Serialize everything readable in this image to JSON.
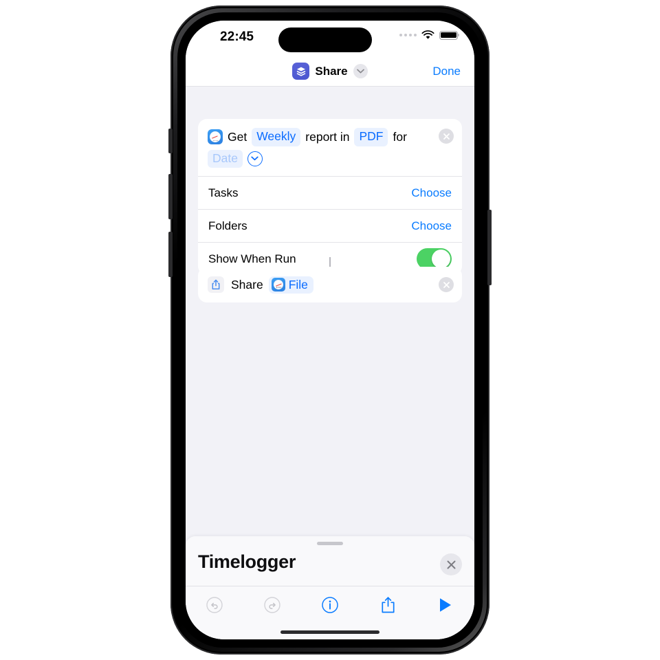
{
  "status_bar": {
    "time": "22:45",
    "cellular_icon": "cellular-dots-icon",
    "wifi_icon": "wifi-icon",
    "battery_icon": "battery-full-icon"
  },
  "nav_bar": {
    "app_icon": "shortcuts-app-icon",
    "title": "Share",
    "chevron_icon": "chevron-down-icon",
    "done_label": "Done"
  },
  "actions": [
    {
      "id": "get-report",
      "app_icon": "timelogger-app-icon",
      "phrase": [
        {
          "kind": "text",
          "value": "Get"
        },
        {
          "kind": "token",
          "value": "Weekly"
        },
        {
          "kind": "text",
          "value": "report in"
        },
        {
          "kind": "token",
          "value": "PDF"
        },
        {
          "kind": "text",
          "value": "for"
        },
        {
          "kind": "placeholder",
          "value": "Date"
        }
      ],
      "expand_icon": "chevron-down-circle-icon",
      "remove_icon": "remove-action-icon",
      "rows": [
        {
          "label": "Tasks",
          "control": "link",
          "value": "Choose"
        },
        {
          "label": "Folders",
          "control": "link",
          "value": "Choose"
        },
        {
          "label": "Show When Run",
          "control": "toggle",
          "value": "on"
        }
      ]
    },
    {
      "id": "share-file",
      "glyph_icon": "share-glyph-icon",
      "label": "Share",
      "token_icon": "timelogger-app-icon",
      "token_label": "File",
      "remove_icon": "remove-action-icon"
    }
  ],
  "sheet": {
    "grabber": "sheet-grabber",
    "title": "Timelogger",
    "close_icon": "close-icon",
    "toolbar": [
      {
        "id": "undo",
        "icon": "undo-icon",
        "state": "disabled"
      },
      {
        "id": "redo",
        "icon": "redo-icon",
        "state": "disabled"
      },
      {
        "id": "info",
        "icon": "info-icon",
        "state": "enabled"
      },
      {
        "id": "share",
        "icon": "share-icon",
        "state": "enabled"
      },
      {
        "id": "run",
        "icon": "play-icon",
        "state": "enabled"
      }
    ]
  },
  "colors": {
    "accent_blue": "#0A7CFF",
    "token_blue": "#0A6CFF",
    "token_bg": "#E9F1FF",
    "toggle_green": "#4CD264",
    "canvas_bg": "#F2F2F7",
    "app_icon_indigo": "#4A56CF"
  }
}
